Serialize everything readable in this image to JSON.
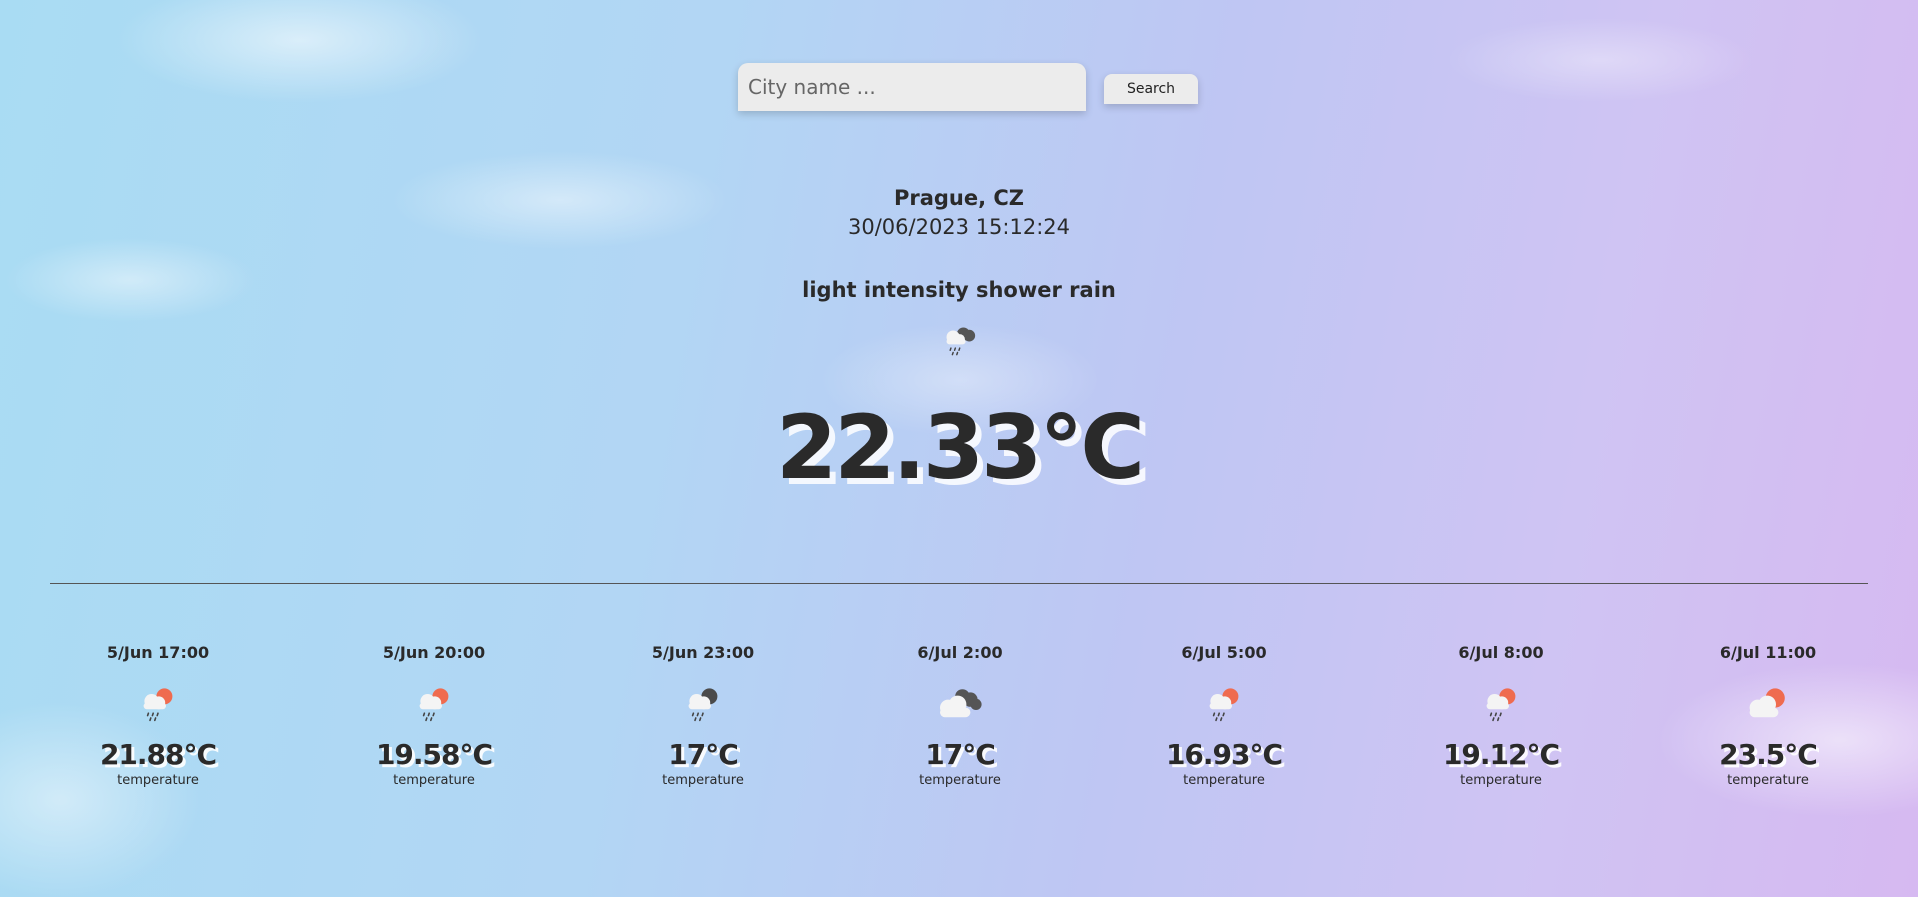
{
  "search": {
    "placeholder": "City name ...",
    "value": "",
    "button_label": "Search"
  },
  "current": {
    "location": "Prague, CZ",
    "datetime": "30/06/2023 15:12:24",
    "description": "light intensity shower rain",
    "icon": "shower-rain-icon",
    "temperature": "22.33°C"
  },
  "forecast": [
    {
      "time": "5/Jun 17:00",
      "icon": "rain-sun-icon",
      "temperature": "21.88°C",
      "label": "temperature"
    },
    {
      "time": "5/Jun 20:00",
      "icon": "rain-sun-icon",
      "temperature": "19.58°C",
      "label": "temperature"
    },
    {
      "time": "5/Jun 23:00",
      "icon": "rain-moon-icon",
      "temperature": "17°C",
      "label": "temperature"
    },
    {
      "time": "6/Jul 2:00",
      "icon": "broken-clouds-icon",
      "temperature": "17°C",
      "label": "temperature"
    },
    {
      "time": "6/Jul 5:00",
      "icon": "rain-sun-icon",
      "temperature": "16.93°C",
      "label": "temperature"
    },
    {
      "time": "6/Jul 8:00",
      "icon": "rain-sun-icon",
      "temperature": "19.12°C",
      "label": "temperature"
    },
    {
      "time": "6/Jul 11:00",
      "icon": "few-clouds-icon",
      "temperature": "23.5°C",
      "label": "temperature"
    }
  ],
  "colors": {
    "text": "#2a2a2a",
    "sun": "#ef6b4f",
    "dark_cloud": "#555555",
    "light_cloud": "#f4f4f4",
    "input_bg": "#ececec"
  }
}
